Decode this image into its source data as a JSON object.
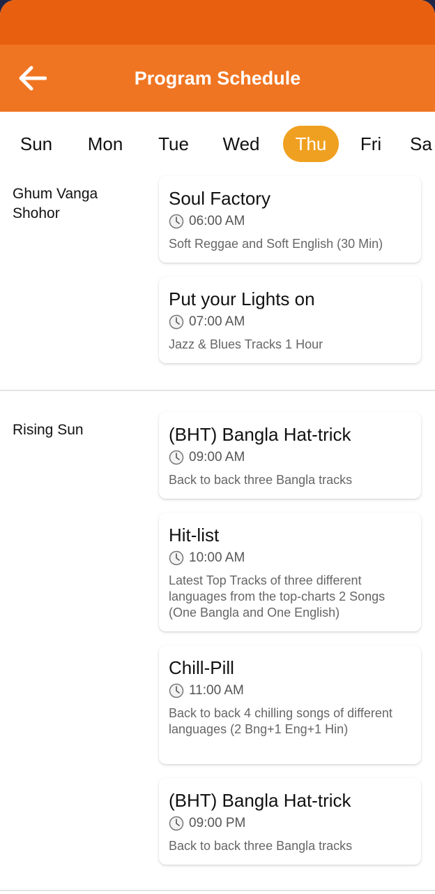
{
  "app_bar": {
    "title": "Program Schedule",
    "back_icon": "arrow-left-icon"
  },
  "colors": {
    "status_bar": "#e8600f",
    "app_bar": "#f07522",
    "selected_tab": "#f0a020"
  },
  "days": [
    {
      "label": "Sun",
      "selected": false
    },
    {
      "label": "Mon",
      "selected": false
    },
    {
      "label": "Tue",
      "selected": false
    },
    {
      "label": "Wed",
      "selected": false
    },
    {
      "label": "Thu",
      "selected": true
    },
    {
      "label": "Fri",
      "selected": false
    },
    {
      "label": "Sa",
      "selected": false
    }
  ],
  "sections": [
    {
      "label": "Ghum Vanga Shohor",
      "programs": [
        {
          "title": "Soul Factory",
          "time": "06:00 AM",
          "description": "Soft Reggae and Soft English (30 Min)"
        },
        {
          "title": "Put your Lights on",
          "time": "07:00 AM",
          "description": "Jazz & Blues Tracks 1 Hour"
        }
      ]
    },
    {
      "label": "Rising Sun",
      "programs": [
        {
          "title": "(BHT) Bangla Hat-trick",
          "time": "09:00 AM",
          "description": "Back to back three Bangla tracks"
        },
        {
          "title": "Hit-list",
          "time": "10:00 AM",
          "description": "Latest Top Tracks of three different languages from the top-charts 2 Songs (One Bangla and One English)"
        },
        {
          "title": "Chill-Pill",
          "time": "11:00 AM",
          "description": "Back to back 4 chilling songs of different languages (2 Bng+1 Eng+1 Hin)"
        },
        {
          "title": "(BHT) Bangla Hat-trick",
          "time": "09:00 PM",
          "description": "Back to back three Bangla tracks"
        }
      ]
    }
  ]
}
